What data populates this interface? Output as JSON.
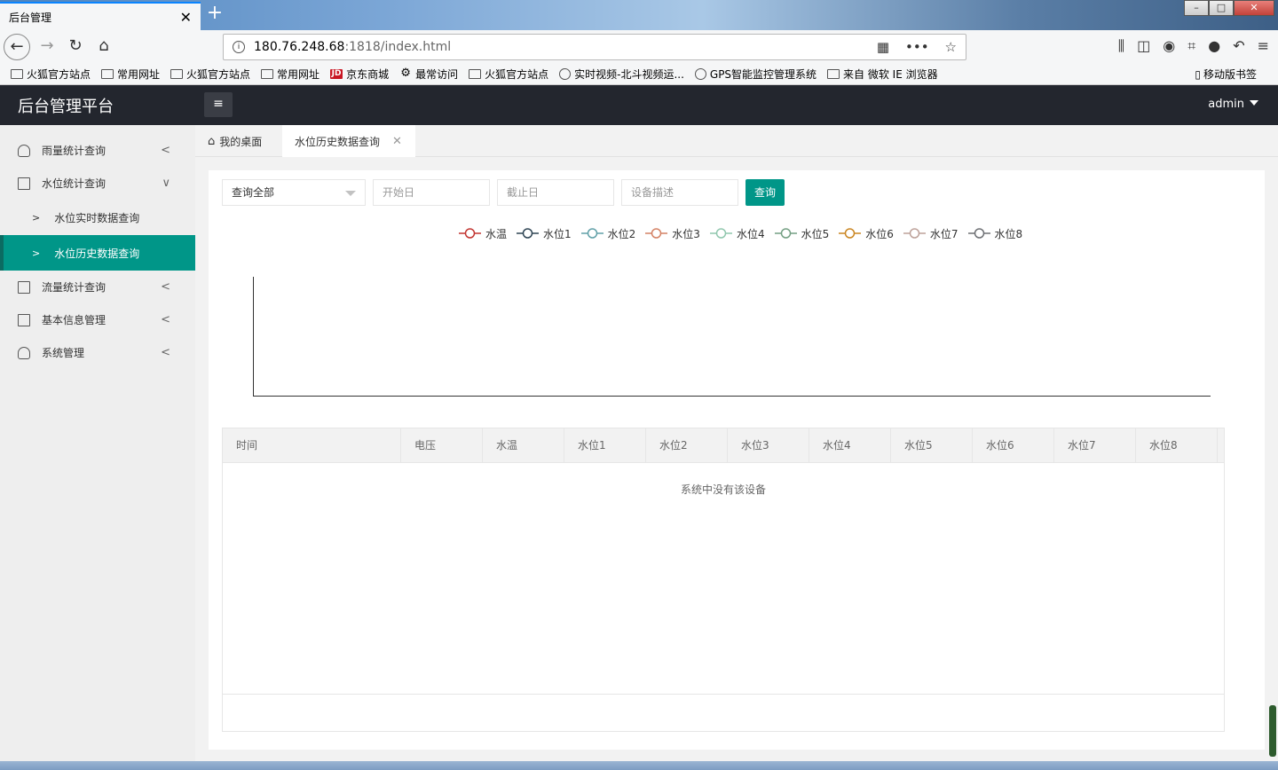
{
  "browser": {
    "tab_title": "后台管理",
    "tab_close": "✕",
    "new_tab": "+",
    "url_host": "180.76.248.68",
    "url_rest": ":1818/index.html"
  },
  "bookmarks": [
    {
      "label": "火狐官方站点",
      "icon": "folder-icon"
    },
    {
      "label": "常用网址",
      "icon": "folder-icon"
    },
    {
      "label": "火狐官方站点",
      "icon": "folder-icon"
    },
    {
      "label": "常用网址",
      "icon": "folder-icon"
    },
    {
      "label": "京东商城",
      "icon": "jd-icon"
    },
    {
      "label": "最常访问",
      "icon": "gear-icon"
    },
    {
      "label": "火狐官方站点",
      "icon": "folder-icon"
    },
    {
      "label": "实时视频-北斗视频运...",
      "icon": "globe-icon"
    },
    {
      "label": "GPS智能监控管理系统",
      "icon": "globe-icon"
    },
    {
      "label": "来自 微软 IE 浏览器",
      "icon": "folder-icon"
    }
  ],
  "mobile_bookmarks": "移动版书签",
  "app": {
    "title": "后台管理平台",
    "user": "admin"
  },
  "sidebar": {
    "items": [
      {
        "label": "雨量统计查询",
        "icon": "user-icon",
        "arrow": "<"
      },
      {
        "label": "水位统计查询",
        "icon": "doc-icon",
        "arrow": "∨"
      },
      {
        "label": "流量统计查询",
        "icon": "doc-icon",
        "arrow": "<"
      },
      {
        "label": "基本信息管理",
        "icon": "doc-icon",
        "arrow": "<"
      },
      {
        "label": "系统管理",
        "icon": "user-icon",
        "arrow": "<"
      }
    ],
    "sub": [
      {
        "label": "水位实时数据查询",
        "active": false
      },
      {
        "label": "水位历史数据查询",
        "active": true
      }
    ]
  },
  "tabs": {
    "home": "我的桌面",
    "current": "水位历史数据查询"
  },
  "filters": {
    "select_value": "查询全部",
    "start_placeholder": "开始日",
    "end_placeholder": "截止日",
    "device_placeholder": "设备描述",
    "query_button": "查询"
  },
  "chart_data": {
    "type": "line",
    "series": [
      {
        "name": "水温",
        "color": "#c23531",
        "values": []
      },
      {
        "name": "水位1",
        "color": "#2f4554",
        "values": []
      },
      {
        "name": "水位2",
        "color": "#61a0a8",
        "values": []
      },
      {
        "name": "水位3",
        "color": "#d48265",
        "values": []
      },
      {
        "name": "水位4",
        "color": "#91c7ae",
        "values": []
      },
      {
        "name": "水位5",
        "color": "#749f83",
        "values": []
      },
      {
        "name": "水位6",
        "color": "#ca8622",
        "values": []
      },
      {
        "name": "水位7",
        "color": "#bda29a",
        "values": []
      },
      {
        "name": "水位8",
        "color": "#6e7074",
        "values": []
      }
    ],
    "legend_position": "top-center",
    "grid": false
  },
  "table": {
    "columns": [
      "时间",
      "电压",
      "水温",
      "水位1",
      "水位2",
      "水位3",
      "水位4",
      "水位5",
      "水位6",
      "水位7",
      "水位8"
    ],
    "empty_text": "系统中没有该设备"
  },
  "colors": {
    "accent": "#009688",
    "header": "#23262e"
  }
}
